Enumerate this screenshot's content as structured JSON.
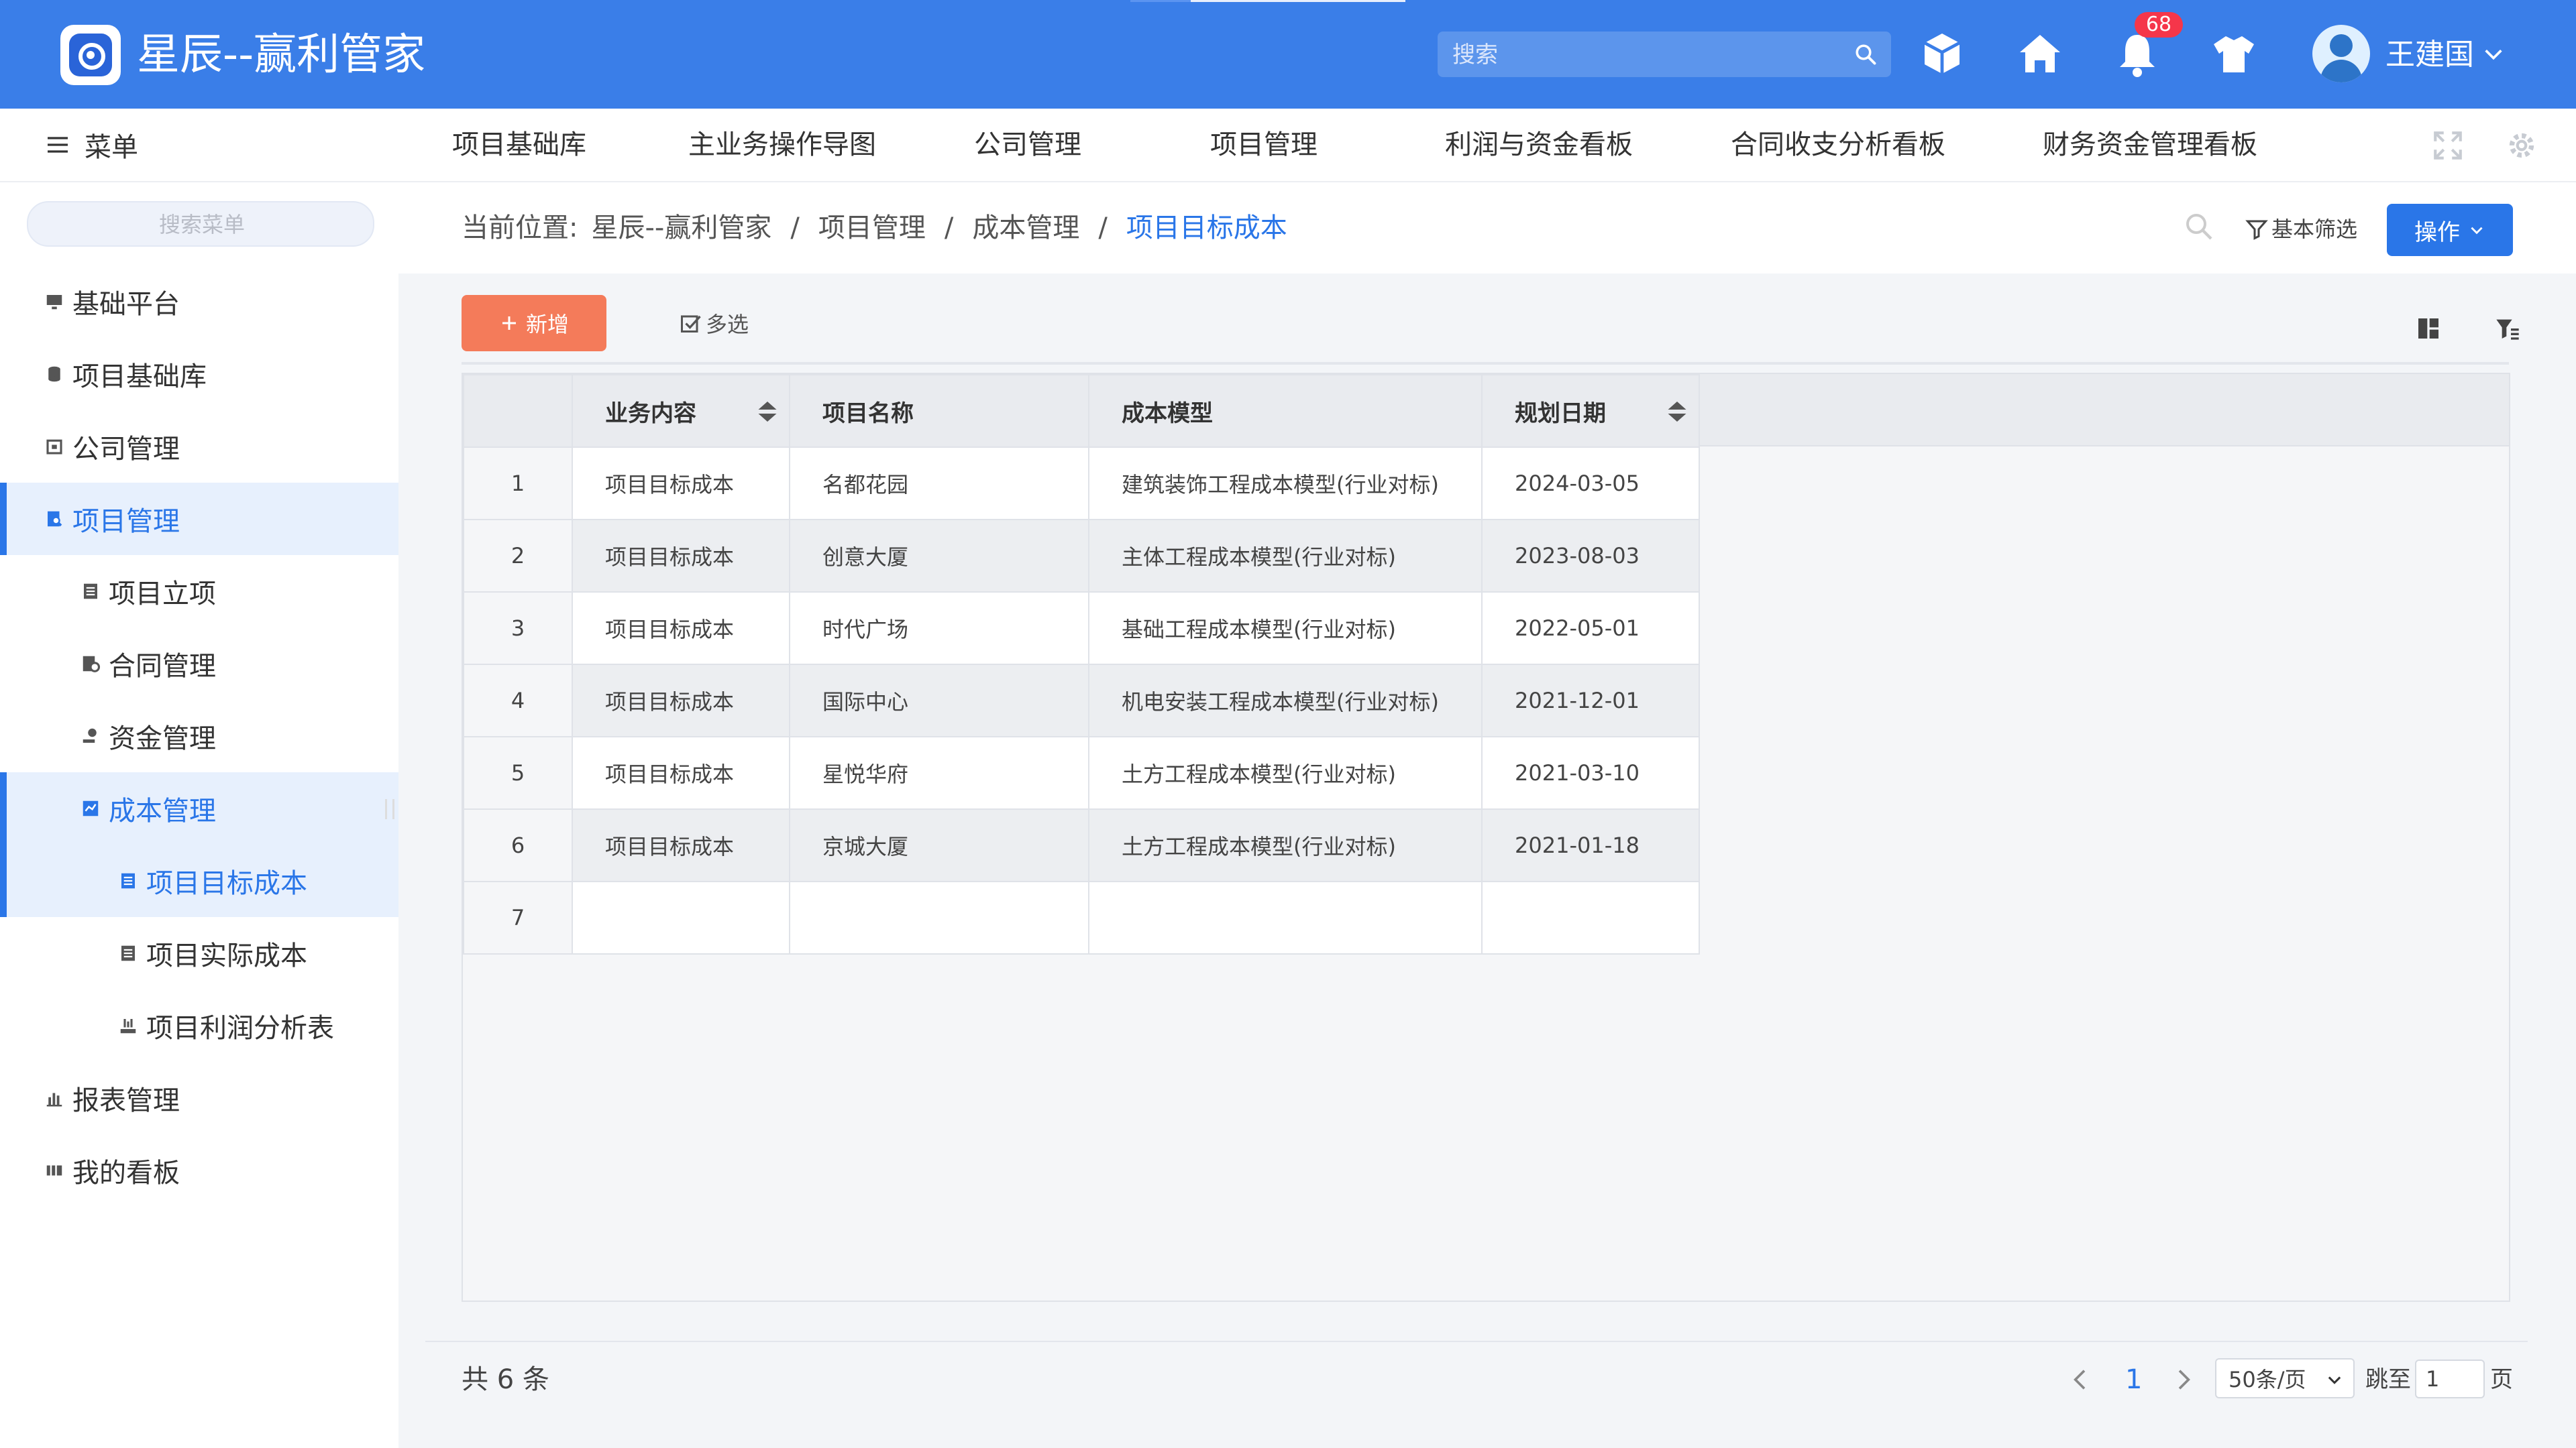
{
  "header": {
    "app_title": "星辰--赢利管家",
    "search_placeholder": "搜索",
    "notification_count": "68",
    "username": "王建国",
    "icons": [
      "cube-icon",
      "home-icon",
      "bell-icon",
      "tshirt-icon"
    ],
    "bg_color": "#3a7ee8"
  },
  "navbar": {
    "menu_label": "菜单",
    "items": [
      "项目基础库",
      "主业务操作导图",
      "公司管理",
      "项目管理",
      "利润与资金看板",
      "合同收支分析看板",
      "财务资金管理看板"
    ]
  },
  "sidebar": {
    "search_placeholder": "搜索菜单",
    "items": [
      {
        "label": "基础平台",
        "icon": "monitor-icon"
      },
      {
        "label": "项目基础库",
        "icon": "database-icon"
      },
      {
        "label": "公司管理",
        "icon": "building-icon"
      },
      {
        "label": "项目管理",
        "icon": "project-icon"
      },
      {
        "label": "项目立项",
        "icon": "list-icon"
      },
      {
        "label": "合同管理",
        "icon": "contract-icon"
      },
      {
        "label": "资金管理",
        "icon": "money-icon"
      },
      {
        "label": "成本管理",
        "icon": "chart-box-icon"
      },
      {
        "label": "项目目标成本",
        "icon": "list-icon"
      },
      {
        "label": "项目实际成本",
        "icon": "list-icon"
      },
      {
        "label": "项目利润分析表",
        "icon": "profit-icon"
      },
      {
        "label": "报表管理",
        "icon": "bar-chart-icon"
      },
      {
        "label": "我的看板",
        "icon": "board-icon"
      }
    ]
  },
  "breadcrumb": {
    "prefix": "当前位置:",
    "items": [
      "星辰--赢利管家",
      "项目管理",
      "成本管理"
    ],
    "current": "项目目标成本",
    "separator": "/"
  },
  "actions": {
    "filter_label": "基本筛选",
    "operation_label": "操作",
    "add_label": "新增",
    "multi_label": "多选"
  },
  "table": {
    "columns": [
      "业务内容",
      "项目名称",
      "成本模型",
      "规划日期"
    ],
    "rows": [
      {
        "no": "1",
        "business": "项目目标成本",
        "project": "名都花园",
        "model": "建筑装饰工程成本模型(行业对标)",
        "date": "2024-03-05"
      },
      {
        "no": "2",
        "business": "项目目标成本",
        "project": "创意大厦",
        "model": "主体工程成本模型(行业对标)",
        "date": "2023-08-03"
      },
      {
        "no": "3",
        "business": "项目目标成本",
        "project": "时代广场",
        "model": "基础工程成本模型(行业对标)",
        "date": "2022-05-01"
      },
      {
        "no": "4",
        "business": "项目目标成本",
        "project": "国际中心",
        "model": "机电安装工程成本模型(行业对标)",
        "date": "2021-12-01"
      },
      {
        "no": "5",
        "business": "项目目标成本",
        "project": "星悦华府",
        "model": "土方工程成本模型(行业对标)",
        "date": "2021-03-10"
      },
      {
        "no": "6",
        "business": "项目目标成本",
        "project": "京城大厦",
        "model": "土方工程成本模型(行业对标)",
        "date": "2021-01-18"
      },
      {
        "no": "7",
        "business": "",
        "project": "",
        "model": "",
        "date": ""
      }
    ]
  },
  "pagination": {
    "total_text": "共 6 条",
    "current_page": "1",
    "page_size": "50条/页",
    "goto_label": "跳至",
    "goto_value": "1",
    "goto_unit": "页"
  },
  "colors": {
    "accent": "#2a76e8",
    "add_button": "#f47b5a",
    "badge": "#f5364a"
  }
}
